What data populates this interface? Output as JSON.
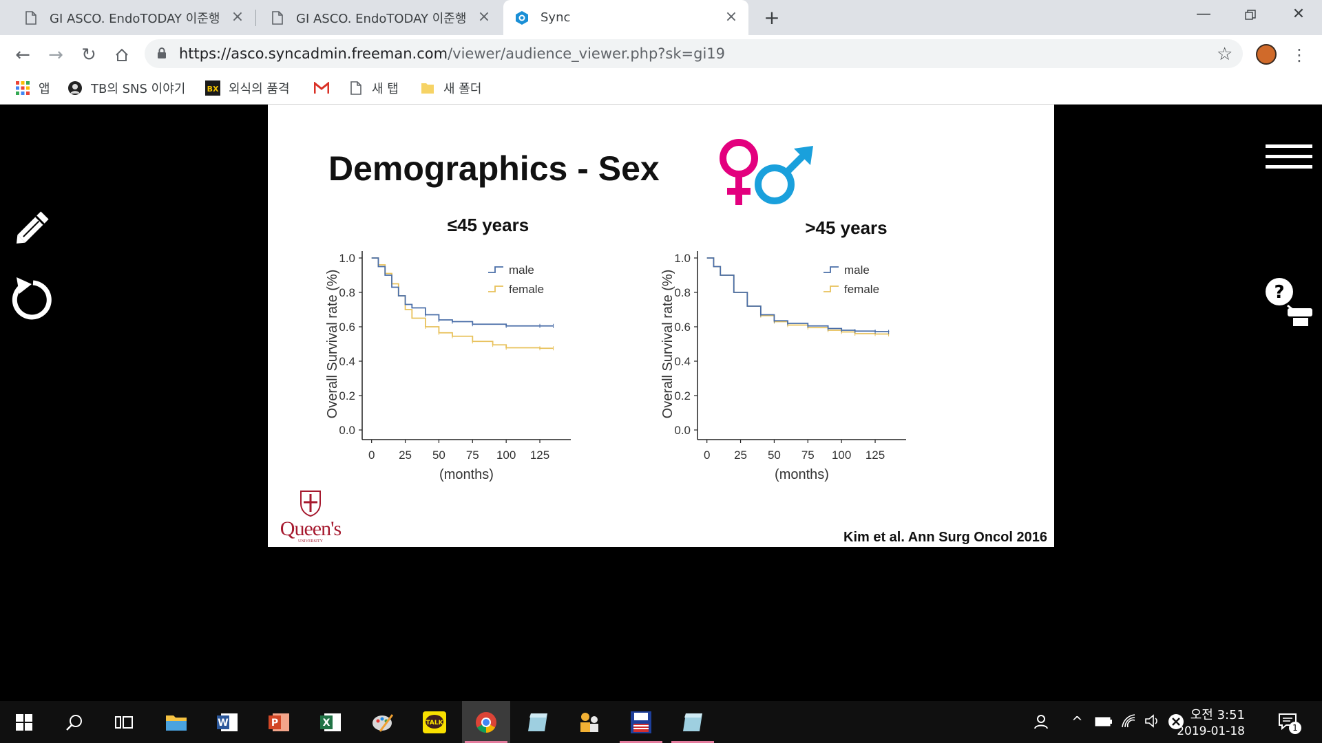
{
  "browser": {
    "tabs": [
      {
        "title": "GI ASCO. EndoTODAY 이준행",
        "active": false
      },
      {
        "title": "GI ASCO. EndoTODAY 이준행",
        "active": false
      },
      {
        "title": "Sync",
        "active": true
      }
    ],
    "url_host": "https://asco.syncadmin.freeman.com",
    "url_path": "/viewer/audience_viewer.php?sk=gi19",
    "bookmarks": [
      {
        "label": "앱",
        "icon": "apps-grid-icon"
      },
      {
        "label": "TB의 SNS 이야기",
        "icon": "avatar-icon"
      },
      {
        "label": "외식의 품격",
        "icon": "bx-icon"
      },
      {
        "label": "",
        "icon": "gmail-icon"
      },
      {
        "label": "새 탭",
        "icon": "page-icon"
      },
      {
        "label": "새 폴더",
        "icon": "folder-icon"
      }
    ]
  },
  "slide": {
    "title": "Demographics - Sex",
    "citation": "Kim et al. Ann Surg Oncol 2016",
    "logo_text": "Queen's",
    "logo_subtext": "UNIVERSITY"
  },
  "chart_data": [
    {
      "type": "line",
      "title": "≤45 years",
      "xlabel": "(months)",
      "ylabel": "Overall Survival rate (%)",
      "xlim": [
        0,
        135
      ],
      "ylim": [
        0,
        1.0
      ],
      "xticks": [
        0,
        25,
        50,
        75,
        100,
        125
      ],
      "yticks": [
        "0.0",
        "0.2",
        "0.4",
        "0.6",
        "0.8",
        "1.0"
      ],
      "legend_position": "top-right",
      "series": [
        {
          "name": "male",
          "color": "#4a6ea8",
          "x": [
            0,
            5,
            10,
            15,
            20,
            25,
            30,
            40,
            50,
            60,
            75,
            100,
            125,
            135
          ],
          "y": [
            1.0,
            0.95,
            0.9,
            0.83,
            0.78,
            0.73,
            0.71,
            0.67,
            0.64,
            0.63,
            0.615,
            0.605,
            0.605,
            0.605
          ]
        },
        {
          "name": "female",
          "color": "#e8c15a",
          "x": [
            0,
            5,
            10,
            15,
            20,
            25,
            30,
            40,
            50,
            60,
            75,
            90,
            100,
            125,
            135
          ],
          "y": [
            1.0,
            0.96,
            0.91,
            0.85,
            0.78,
            0.7,
            0.65,
            0.6,
            0.565,
            0.545,
            0.515,
            0.495,
            0.478,
            0.475,
            0.475
          ]
        }
      ]
    },
    {
      "type": "line",
      "title": ">45 years",
      "xlabel": "(months)",
      "ylabel": "Overall Survival rate (%)",
      "xlim": [
        0,
        135
      ],
      "ylim": [
        0,
        1.0
      ],
      "xticks": [
        0,
        25,
        50,
        75,
        100,
        125
      ],
      "yticks": [
        "0.0",
        "0.2",
        "0.4",
        "0.6",
        "0.8",
        "1.0"
      ],
      "legend_position": "top-right",
      "series": [
        {
          "name": "male",
          "color": "#4a6ea8",
          "x": [
            0,
            5,
            10,
            20,
            30,
            40,
            50,
            60,
            75,
            90,
            100,
            110,
            125,
            135
          ],
          "y": [
            1.0,
            0.95,
            0.9,
            0.8,
            0.72,
            0.67,
            0.635,
            0.62,
            0.605,
            0.59,
            0.58,
            0.575,
            0.572,
            0.57
          ]
        },
        {
          "name": "female",
          "color": "#e8c15a",
          "x": [
            0,
            5,
            10,
            20,
            30,
            40,
            50,
            60,
            75,
            90,
            100,
            110,
            125,
            135
          ],
          "y": [
            1.0,
            0.95,
            0.9,
            0.8,
            0.72,
            0.665,
            0.63,
            0.61,
            0.595,
            0.58,
            0.57,
            0.56,
            0.558,
            0.556
          ]
        }
      ]
    }
  ],
  "taskbar": {
    "time": "오전 3:51",
    "date": "2019-01-18",
    "notification_count": "1",
    "apps": [
      "windows-start-icon",
      "search-icon",
      "task-view-icon",
      "file-explorer-icon",
      "word-icon",
      "powerpoint-icon",
      "excel-icon",
      "paint-icon",
      "kakaotalk-icon",
      "chrome-icon",
      "app-icon",
      "people-app-icon",
      "save-app-icon",
      "app-icon-2"
    ]
  }
}
